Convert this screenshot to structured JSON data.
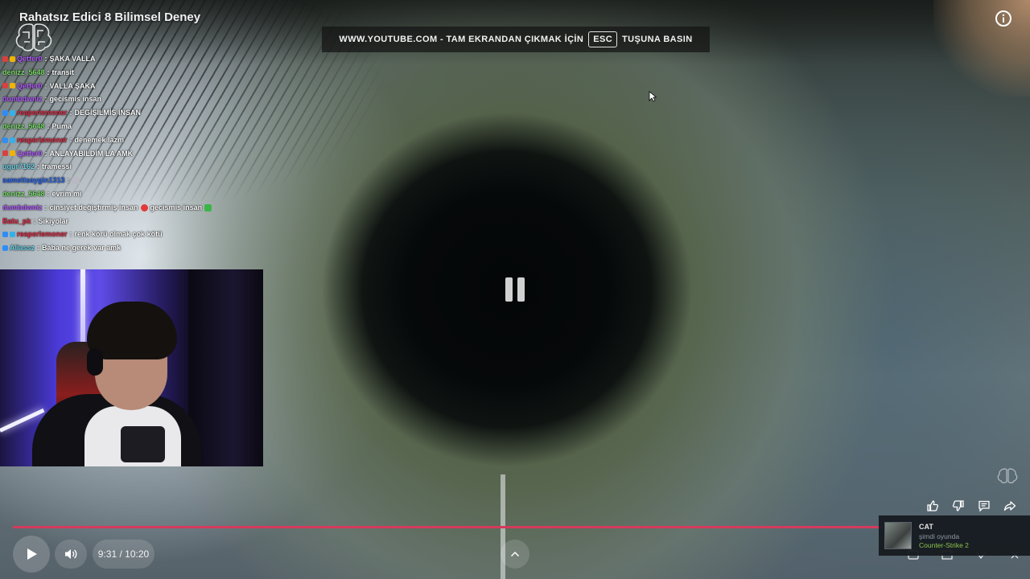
{
  "video": {
    "title": "Rahatsız Edici 8 Bilimsel Deney"
  },
  "fullscreen_banner": {
    "text_before": "WWW.YOUTUBE.COM - TAM EKRANDAN ÇIKMAK İÇİN",
    "key": "ESC",
    "text_after": "TUŞUNA BASIN"
  },
  "chat": {
    "messages": [
      {
        "user": "Qetfer0",
        "text": "ŞAKA VALLA",
        "color": "#b45cff",
        "badges": [
          "#d94040",
          "#f0b400"
        ]
      },
      {
        "user": "denizz_5648",
        "text": "transit",
        "color": "#7bdc6b",
        "badges": []
      },
      {
        "user": "Qetfer0",
        "text": "VALLA ŞAKA",
        "color": "#b45cff",
        "badges": [
          "#d94040",
          "#f0b400"
        ]
      },
      {
        "user": "dumbdwniz",
        "text": "gecismis insan",
        "color": "#b45cff",
        "badges": []
      },
      {
        "user": "reaperlemoner",
        "text": "DEGİŞİLMİŞ İNSAN",
        "color": "#e0304a",
        "badges": [
          "#2f8df5",
          "#35b0e8"
        ]
      },
      {
        "user": "denizz_5648",
        "text": "Puma",
        "color": "#7bdc6b",
        "badges": []
      },
      {
        "user": "reaperlemoner",
        "text": "denemek lazm",
        "color": "#e0304a",
        "badges": [
          "#2f8df5",
          "#35b0e8"
        ]
      },
      {
        "user": "Qetfer0",
        "text": "ANLAYABİLDİM LA AMK",
        "color": "#b45cff",
        "badges": [
          "#d94040",
          "#f0b400"
        ]
      },
      {
        "user": "ugur7162",
        "text": "tramessi",
        "color": "#6bd3e8",
        "badges": []
      },
      {
        "user": "samettsaygin1313",
        "text": "",
        "color": "#2f6df5",
        "badges": [],
        "emote_after_colon": "#b8b8c0"
      },
      {
        "user": "denizz_5648",
        "text": "evrim mi",
        "color": "#7bdc6b",
        "badges": []
      },
      {
        "user": "dumbdwniz",
        "text": "cinsiyet değiştirmiş insan",
        "color": "#b45cff",
        "badges": [],
        "emote_mid": "#e23a3a",
        "text2": "gecismis insan",
        "emote_end": "#3bb54a"
      },
      {
        "user": "Batu_pk",
        "text": "Sikiyolar",
        "color": "#e0304a",
        "badges": []
      },
      {
        "user": "reaperlemoner",
        "text": "renk körü olmak çok kötü",
        "color": "#e0304a",
        "badges": [
          "#2f8df5",
          "#35b0e8"
        ]
      },
      {
        "user": "Aliassz",
        "text": "Baba ne gerek var amk",
        "color": "#6bd3e8",
        "badges": [
          "#2f8df5"
        ]
      }
    ]
  },
  "player": {
    "time": "9:31 / 10:20",
    "progress": 0.915,
    "state": "paused"
  },
  "steam_toast": {
    "name": "CAT",
    "status": "şimdi oyunda",
    "game": "Counter-Strike 2"
  },
  "colors": {
    "progress": "#d43b5c",
    "toast_game": "#8bc34a"
  },
  "icons": [
    "logo-icon",
    "info-icon",
    "play-icon",
    "volume-icon",
    "chevron-up-icon",
    "pause-icon",
    "like-icon",
    "dislike-icon",
    "comment-icon",
    "share-icon",
    "cursor-icon"
  ]
}
